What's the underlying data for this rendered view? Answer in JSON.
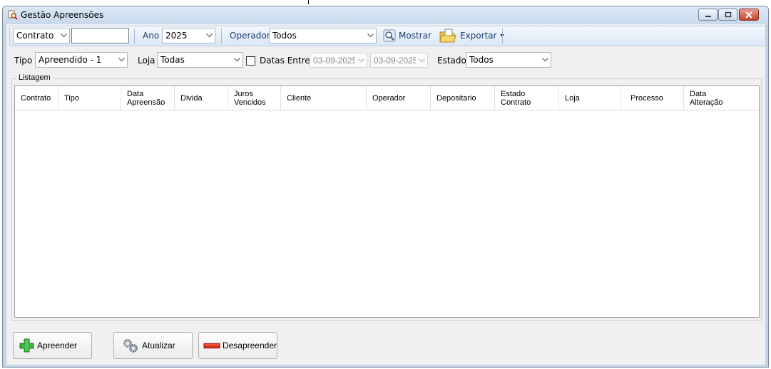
{
  "window": {
    "title": "Gestão Apreensões",
    "icon": "search-doc-icon"
  },
  "toolbar": {
    "field_combo": "Contrato",
    "field_text": "",
    "ano_label": "Ano",
    "ano_value": "2025",
    "operador_label": "Operador",
    "operador_value": "Todos",
    "mostrar_label": "Mostrar",
    "exportar_label": "Exportar"
  },
  "filters": {
    "tipo_label": "Tipo",
    "tipo_value": "Apreendido - 1",
    "loja_label": "Loja",
    "loja_value": "Todas",
    "datas_label": "Datas Entre",
    "datas_checked": false,
    "date_from": "03-09-2025",
    "date_to": "03-09-2025",
    "estado_label": "Estado",
    "estado_value": "Todos"
  },
  "listagem": {
    "label": "Listagem",
    "columns": [
      {
        "l1": "Contrato",
        "l2": ""
      },
      {
        "l1": "Tipo",
        "l2": ""
      },
      {
        "l1": "Data",
        "l2": "Apreensão"
      },
      {
        "l1": "Divida",
        "l2": ""
      },
      {
        "l1": "Juros",
        "l2": "Vencidos"
      },
      {
        "l1": "Cliente",
        "l2": ""
      },
      {
        "l1": "Operador",
        "l2": ""
      },
      {
        "l1": "Depositario",
        "l2": ""
      },
      {
        "l1": "Estado",
        "l2": "Contrato"
      },
      {
        "l1": "Loja",
        "l2": ""
      },
      {
        "l1": "Processo",
        "l2": ""
      },
      {
        "l1": "Data",
        "l2": "Alteração"
      }
    ]
  },
  "actions": {
    "apreender": "Apreender",
    "atualizar": "Atualizar",
    "desapreender": "Desapreender"
  },
  "colors": {
    "accent_text": "#1d3b6e",
    "add_green": "#3cb043",
    "remove_red": "#d9301e"
  }
}
